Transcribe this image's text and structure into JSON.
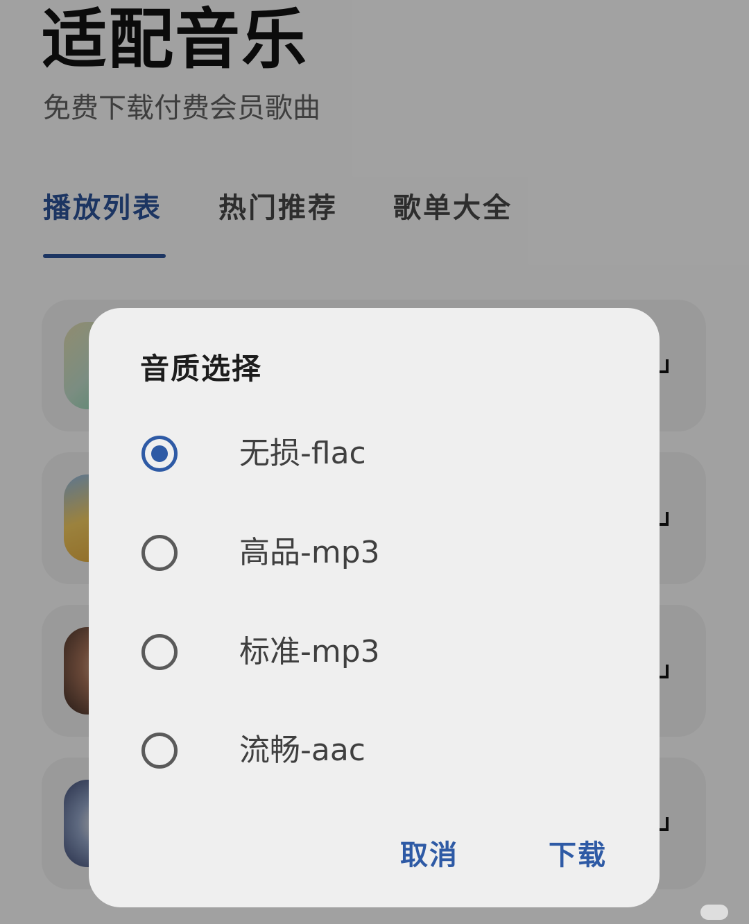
{
  "app": {
    "title": "适配音乐",
    "subtitle": "免费下载付费会员歌曲"
  },
  "tabs": [
    {
      "label": "播放列表",
      "active": true
    },
    {
      "label": "热门推荐",
      "active": false
    },
    {
      "label": "歌单大全",
      "active": false
    }
  ],
  "dialog": {
    "title": "音质选择",
    "options": [
      {
        "label": "无损-flac",
        "selected": true
      },
      {
        "label": "高品-mp3",
        "selected": false
      },
      {
        "label": "标准-mp3",
        "selected": false
      },
      {
        "label": "流畅-aac",
        "selected": false
      }
    ],
    "cancel_label": "取消",
    "confirm_label": "下载"
  },
  "colors": {
    "accent": "#2e5aa5",
    "scrim": "rgba(0,0,0,0.33)",
    "dialog_background": "#efefef"
  }
}
